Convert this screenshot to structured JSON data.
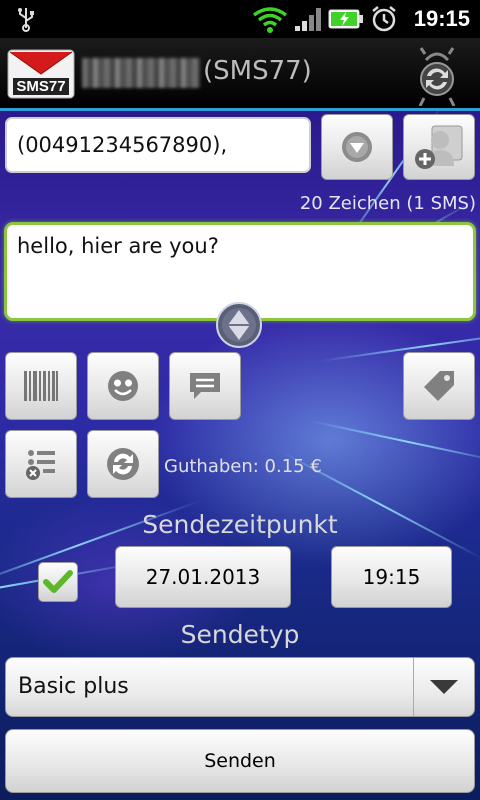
{
  "status_bar": {
    "time": "19:15",
    "icons": [
      "usb-icon",
      "wifi-icon",
      "signal-icon",
      "battery-charging-icon",
      "alarm-icon"
    ]
  },
  "header": {
    "title_suffix": "(SMS77)",
    "logo_text": "SMS77",
    "logo_icon": "envelope-logo-icon",
    "sync_icon": "sync-icon"
  },
  "recipient": {
    "value": "(00491234567890),"
  },
  "char_count": "20 Zeichen (1 SMS)",
  "message": {
    "value": "hello, hier are you?"
  },
  "toolbar": {
    "icons": [
      "barcode-icon",
      "smiley-icon",
      "message-template-icon",
      "tag-icon",
      "list-options-icon",
      "refresh-icon"
    ]
  },
  "credit": "Guthaben: 0.15 €",
  "schedule": {
    "heading": "Sendezeitpunkt",
    "checked": true,
    "date": "27.01.2013",
    "time": "19:15"
  },
  "send_type": {
    "heading": "Sendetyp",
    "selected": "Basic plus"
  },
  "send_button": "Senden",
  "colors": {
    "accent": "#2f9fd8",
    "focus_border": "#8cc63f",
    "checkbox_check": "#5cb82a"
  }
}
